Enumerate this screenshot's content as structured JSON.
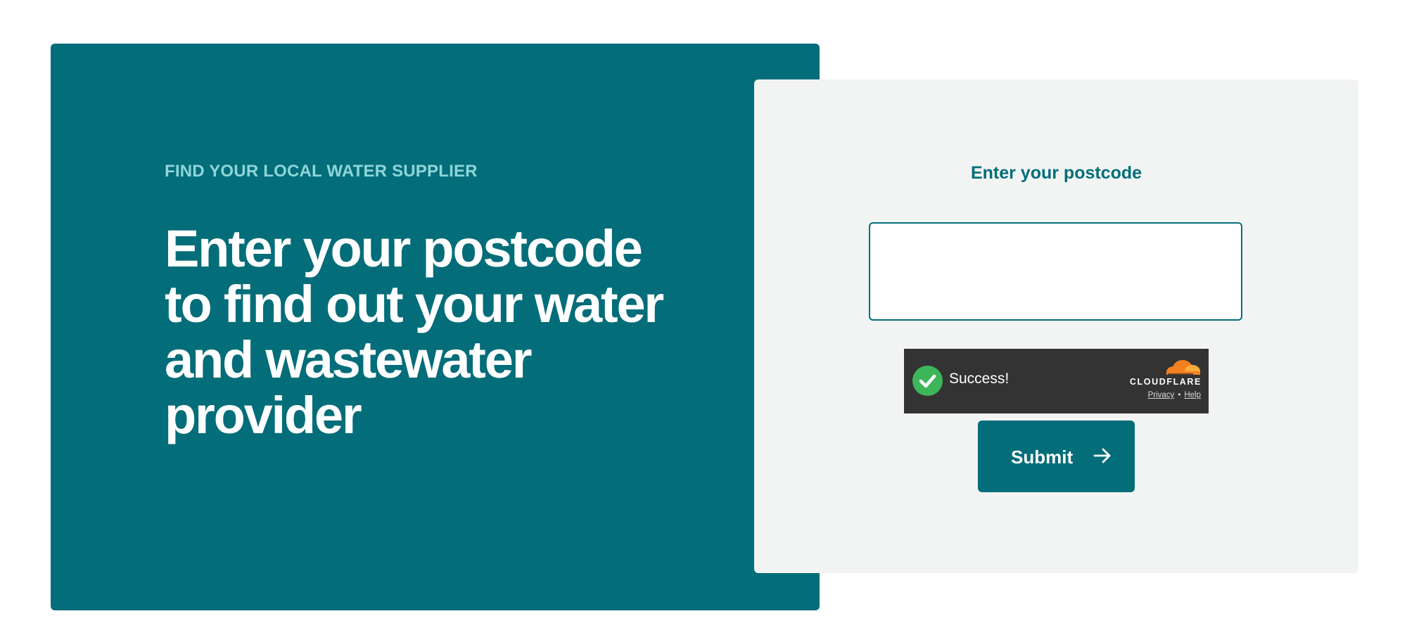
{
  "hero": {
    "eyebrow": "FIND YOUR LOCAL WATER SUPPLIER",
    "headline": "Enter your postcode to find out your water and wastewater provider",
    "background_color": "#036d79",
    "eyebrow_color": "#8fd5d8"
  },
  "form": {
    "label": "Enter your postcode",
    "postcode_value": "",
    "submit_label": "Submit",
    "submit_icon": "arrow-right-icon",
    "card_color": "#f2f4f3"
  },
  "captcha": {
    "status_text": "Success!",
    "status_icon": "checkmark-icon",
    "brand": "CLOUDFLARE",
    "privacy_label": "Privacy",
    "separator": "•",
    "help_label": "Help",
    "success_color": "#3db65a",
    "brand_color": "#f48120"
  }
}
